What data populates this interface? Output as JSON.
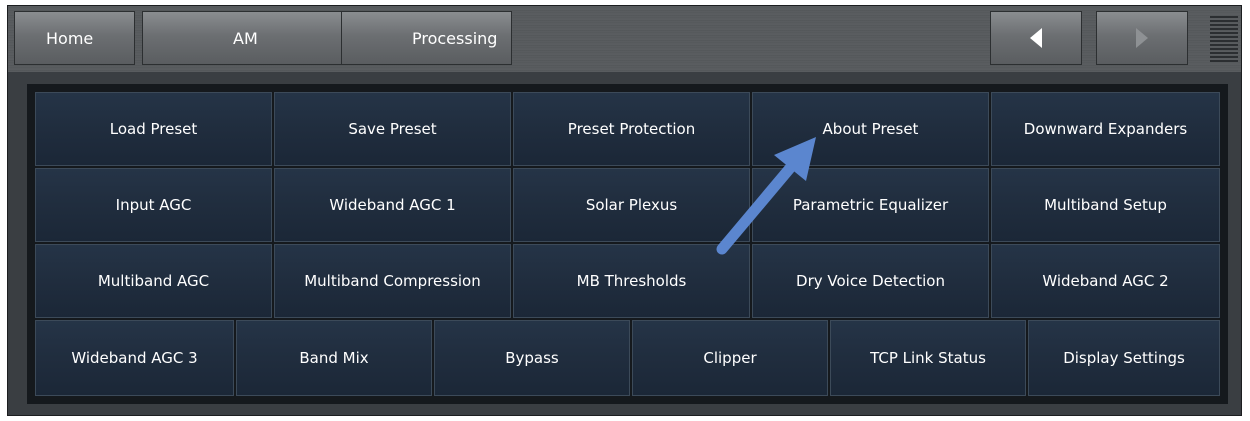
{
  "breadcrumb": {
    "home": "Home",
    "am": "AM",
    "processing": "Processing"
  },
  "nav": {
    "prev_icon": "triangle-left-icon",
    "next_icon": "triangle-right-icon",
    "menu_icon": "hamburger-menu-icon"
  },
  "colors": {
    "button_bg": "#223043",
    "panel_bg": "#15191d",
    "arrow": "#5b86cf"
  },
  "grid": {
    "row1": [
      "Load Preset",
      "Save Preset",
      "Preset Protection",
      "About Preset",
      "Downward Expanders"
    ],
    "row2": [
      "Input AGC",
      "Wideband AGC 1",
      "Solar Plexus",
      "Parametric Equalizer",
      "Multiband Setup"
    ],
    "row3": [
      "Multiband AGC",
      "Multiband Compression",
      "MB Thresholds",
      "Dry Voice Detection",
      "Wideband AGC 2"
    ],
    "row4": [
      "Wideband AGC 3",
      "Band Mix",
      "Bypass",
      "Clipper",
      "TCP Link Status",
      "Display Settings"
    ]
  }
}
